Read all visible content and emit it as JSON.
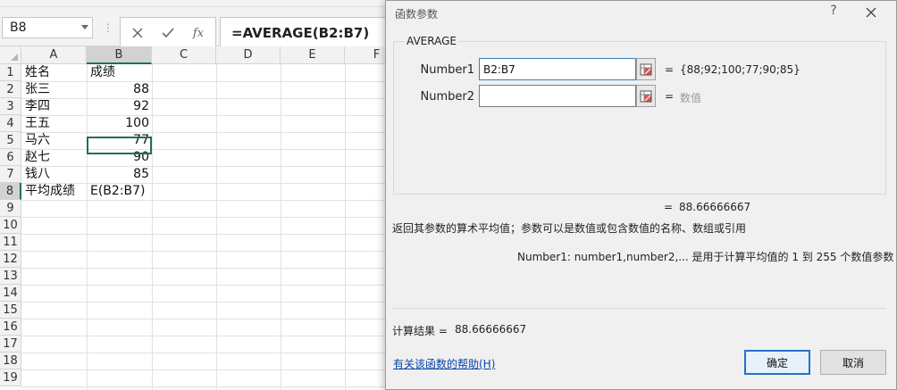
{
  "formula_bar": {
    "name_box": "B8",
    "formula": "=AVERAGE(B2:B7)",
    "cancel_icon": "close-icon",
    "enter_icon": "check-icon",
    "fx_label": "fx"
  },
  "sheet": {
    "columns": [
      "A",
      "B",
      "C",
      "D",
      "E",
      "F"
    ],
    "rows": [
      "1",
      "2",
      "3",
      "4",
      "5",
      "6",
      "7",
      "8",
      "9",
      "10",
      "11",
      "12",
      "13",
      "14",
      "15",
      "16",
      "17",
      "18",
      "19"
    ],
    "cells": {
      "A1": "姓名",
      "B1": "成绩",
      "A2": "张三",
      "B2": "88",
      "A3": "李四",
      "B3": "92",
      "A4": "王五",
      "B4": "100",
      "A5": "马六",
      "B5": "77",
      "A6": "赵七",
      "B6": "90",
      "A7": "钱八",
      "B7": "85",
      "A8": "平均成绩",
      "B8": "E(B2:B7)"
    }
  },
  "dialog": {
    "title": "函数参数",
    "help_label": "?",
    "function_name": "AVERAGE",
    "args": [
      {
        "label": "Number1",
        "value": "B2:B7",
        "eq": "=",
        "result": "{88;92;100;77;90;85}"
      },
      {
        "label": "Number2",
        "value": "",
        "eq": "=",
        "result": "数值"
      }
    ],
    "formula_eq": "=",
    "formula_result": "88.66666667",
    "description": "返回其参数的算术平均值；参数可以是数值或包含数值的名称、数组或引用",
    "arg_help": "Number1:   number1,number2,... 是用于计算平均值的 1 到 255 个数值参数",
    "calc_label": "计算结果 =",
    "calc_value": "88.66666667",
    "help_link": "有关该函数的帮助(H)",
    "ok_label": "确定",
    "cancel_label": "取消"
  }
}
